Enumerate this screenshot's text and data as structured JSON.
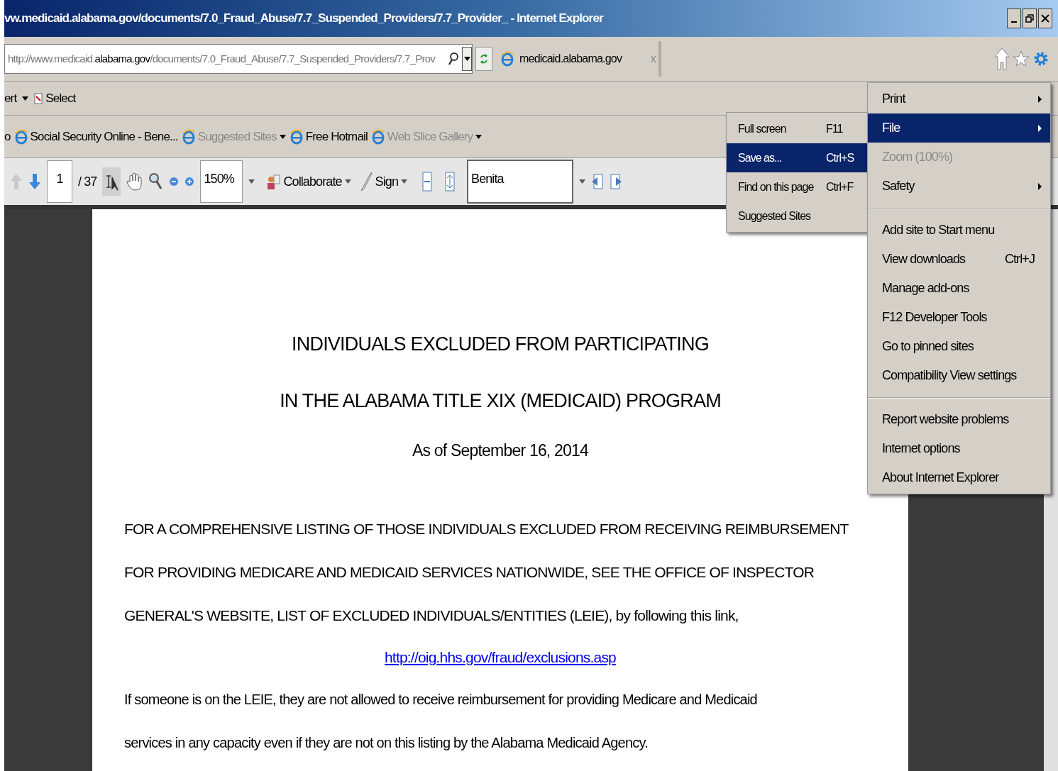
{
  "window": {
    "title": "vw.medicaid.alabama.gov/documents/7.0_Fraud_Abuse/7.7_Suspended_Providers/7.7_Provider_ - Internet Explorer"
  },
  "address_bar": {
    "url_prefix": "http://www.medicaid.",
    "url_domain": "alabama.gov",
    "url_rest": "/documents/7.0_Fraud_Abuse/7.7_Suspended_Providers/7.7_Prov",
    "tab_label": "medicaid.alabama.gov",
    "tab_close": "x"
  },
  "command_bar": {
    "cut_item": "ert",
    "select": "Select"
  },
  "favorites": [
    {
      "label": "o",
      "dimmed": false,
      "dropdown": false,
      "icon": false
    },
    {
      "label": "Social Security Online - Bene...",
      "dimmed": false,
      "dropdown": false,
      "icon": true
    },
    {
      "label": "Suggested Sites",
      "dimmed": true,
      "dropdown": true,
      "icon": true
    },
    {
      "label": "Free Hotmail",
      "dimmed": false,
      "dropdown": false,
      "icon": true
    },
    {
      "label": "Web Slice Gallery",
      "dimmed": true,
      "dropdown": true,
      "icon": true
    }
  ],
  "pdf_toolbar": {
    "page": "1",
    "page_total": "/ 37",
    "zoom": "150%",
    "collaborate": "Collaborate",
    "sign": "Sign",
    "search": "Benita"
  },
  "tools_menu": [
    {
      "kind": "item",
      "label": "Print",
      "submenu": true,
      "selected": false,
      "disabled": false
    },
    {
      "kind": "item",
      "label": "File",
      "submenu": true,
      "selected": true,
      "disabled": false
    },
    {
      "kind": "item",
      "label": "Zoom (100%)",
      "submenu": false,
      "selected": false,
      "disabled": true
    },
    {
      "kind": "item",
      "label": "Safety",
      "submenu": true,
      "selected": false,
      "disabled": false
    },
    {
      "kind": "separator"
    },
    {
      "kind": "item",
      "label": "Add site to Start menu",
      "submenu": false,
      "selected": false,
      "disabled": false
    },
    {
      "kind": "item",
      "label": "View downloads",
      "shortcut": "Ctrl+J",
      "submenu": false,
      "selected": false,
      "disabled": false
    },
    {
      "kind": "item",
      "label": "Manage add-ons",
      "submenu": false,
      "selected": false,
      "disabled": false
    },
    {
      "kind": "item",
      "label": "F12 Developer Tools",
      "submenu": false,
      "selected": false,
      "disabled": false
    },
    {
      "kind": "item",
      "label": "Go to pinned sites",
      "submenu": false,
      "selected": false,
      "disabled": false
    },
    {
      "kind": "item",
      "label": "Compatibility View settings",
      "submenu": false,
      "selected": false,
      "disabled": false
    },
    {
      "kind": "separator"
    },
    {
      "kind": "item",
      "label": "Report website problems",
      "submenu": false,
      "selected": false,
      "disabled": false
    },
    {
      "kind": "item",
      "label": "Internet options",
      "submenu": false,
      "selected": false,
      "disabled": false
    },
    {
      "kind": "item",
      "label": "About Internet Explorer",
      "submenu": false,
      "selected": false,
      "disabled": false
    }
  ],
  "file_submenu": [
    {
      "label": "Full screen",
      "shortcut": "F11",
      "selected": false
    },
    {
      "label": "Save as...",
      "shortcut": "Ctrl+S",
      "selected": true
    },
    {
      "label": "Find on this page",
      "shortcut": "Ctrl+F",
      "selected": false
    },
    {
      "label": "Suggested Sites",
      "selected": false
    }
  ],
  "document": {
    "heading": [
      "INDIVIDUALS EXCLUDED FROM PARTICIPATING",
      "IN THE ALABAMA TITLE XIX (MEDICAID) PROGRAM"
    ],
    "date": "As of September 16, 2014",
    "paragraph_lines": [
      "FOR A COMPREHENSIVE LISTING OF THOSE INDIVIDUALS EXCLUDED FROM RECEIVING REIMBURSEMENT",
      "FOR PROVIDING MEDICARE AND MEDICAID SERVICES NATIONWIDE, SEE THE OFFICE OF INSPECTOR",
      "GENERAL'S WEBSITE, LIST OF EXCLUDED INDIVIDUALS/ENTITIES (LEIE), by following this link,"
    ],
    "link": "http://oig.hhs.gov/fraud/exclusions.asp",
    "paragraph2_lines": [
      "If someone is on the LEIE, they are not allowed to receive reimbursement for providing Medicare and Medicaid",
      "services in any capacity even if they are not on this listing by the Alabama Medicaid Agency."
    ]
  }
}
